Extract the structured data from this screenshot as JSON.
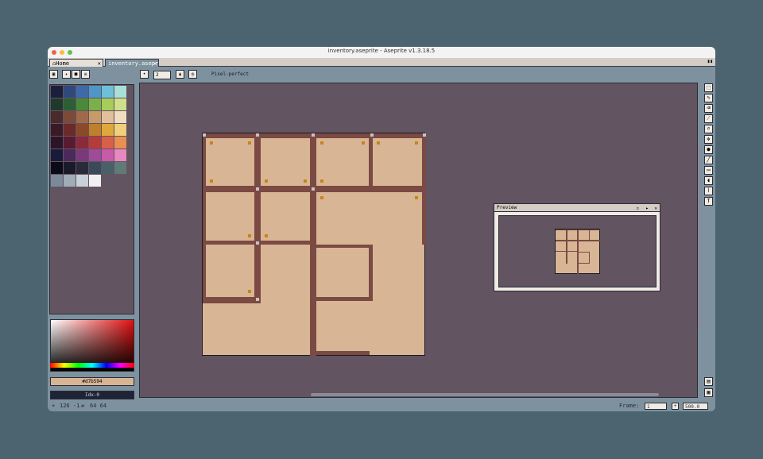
{
  "window": {
    "title": "inventory.aseprite - Aseprite v1.3.18.5"
  },
  "tabs": [
    {
      "label": "Home",
      "close": "✕",
      "active": false
    },
    {
      "label": "inventory.asepr",
      "close": "✕",
      "active": true
    }
  ],
  "toolbar": {
    "brush_size": "2",
    "pixel_perfect_label": "Pixel-perfect"
  },
  "palette": {
    "colors": [
      "#1b1f3b",
      "#2f4a7a",
      "#3f6aa8",
      "#4f96c8",
      "#6cc0d8",
      "#a8e0d8",
      "#1f3a2a",
      "#2e5e36",
      "#4a8a3a",
      "#7ab04a",
      "#a8cc5a",
      "#d0e08a",
      "#4a2a2a",
      "#7a4a3a",
      "#a06a4a",
      "#c89a6a",
      "#e0c09a",
      "#f0dcc0",
      "#3a1a26",
      "#6a2a2a",
      "#8a4a2a",
      "#c0802a",
      "#e0a83a",
      "#f0d07a",
      "#2a1426",
      "#5a1a30",
      "#8a2a3a",
      "#b83a3a",
      "#d8604a",
      "#e89050",
      "#1a1a3a",
      "#4a2a5a",
      "#7a3a7a",
      "#a04a9a",
      "#c85aaa",
      "#e888c0",
      "#0a0a18",
      "#1a1a2a",
      "#2a2a3a",
      "#3a4a5a",
      "#4a6068",
      "#607a78",
      "#7a8a98",
      "#a0acb8",
      "#c8d0d8",
      "#f0f0f0"
    ],
    "fg_color_hex": "#d7b594",
    "bg_index_label": "Idx-0"
  },
  "preview": {
    "title": "Preview"
  },
  "status": {
    "coords": "126  -1",
    "size": "64  64",
    "frame_label": "Frame:",
    "frame_value": "1",
    "zoom": "500.0"
  },
  "colors": {
    "floor": "#d8b594",
    "wall": "#7a4a43",
    "canvas_bg": "#625461",
    "stud": "#c8841a"
  }
}
